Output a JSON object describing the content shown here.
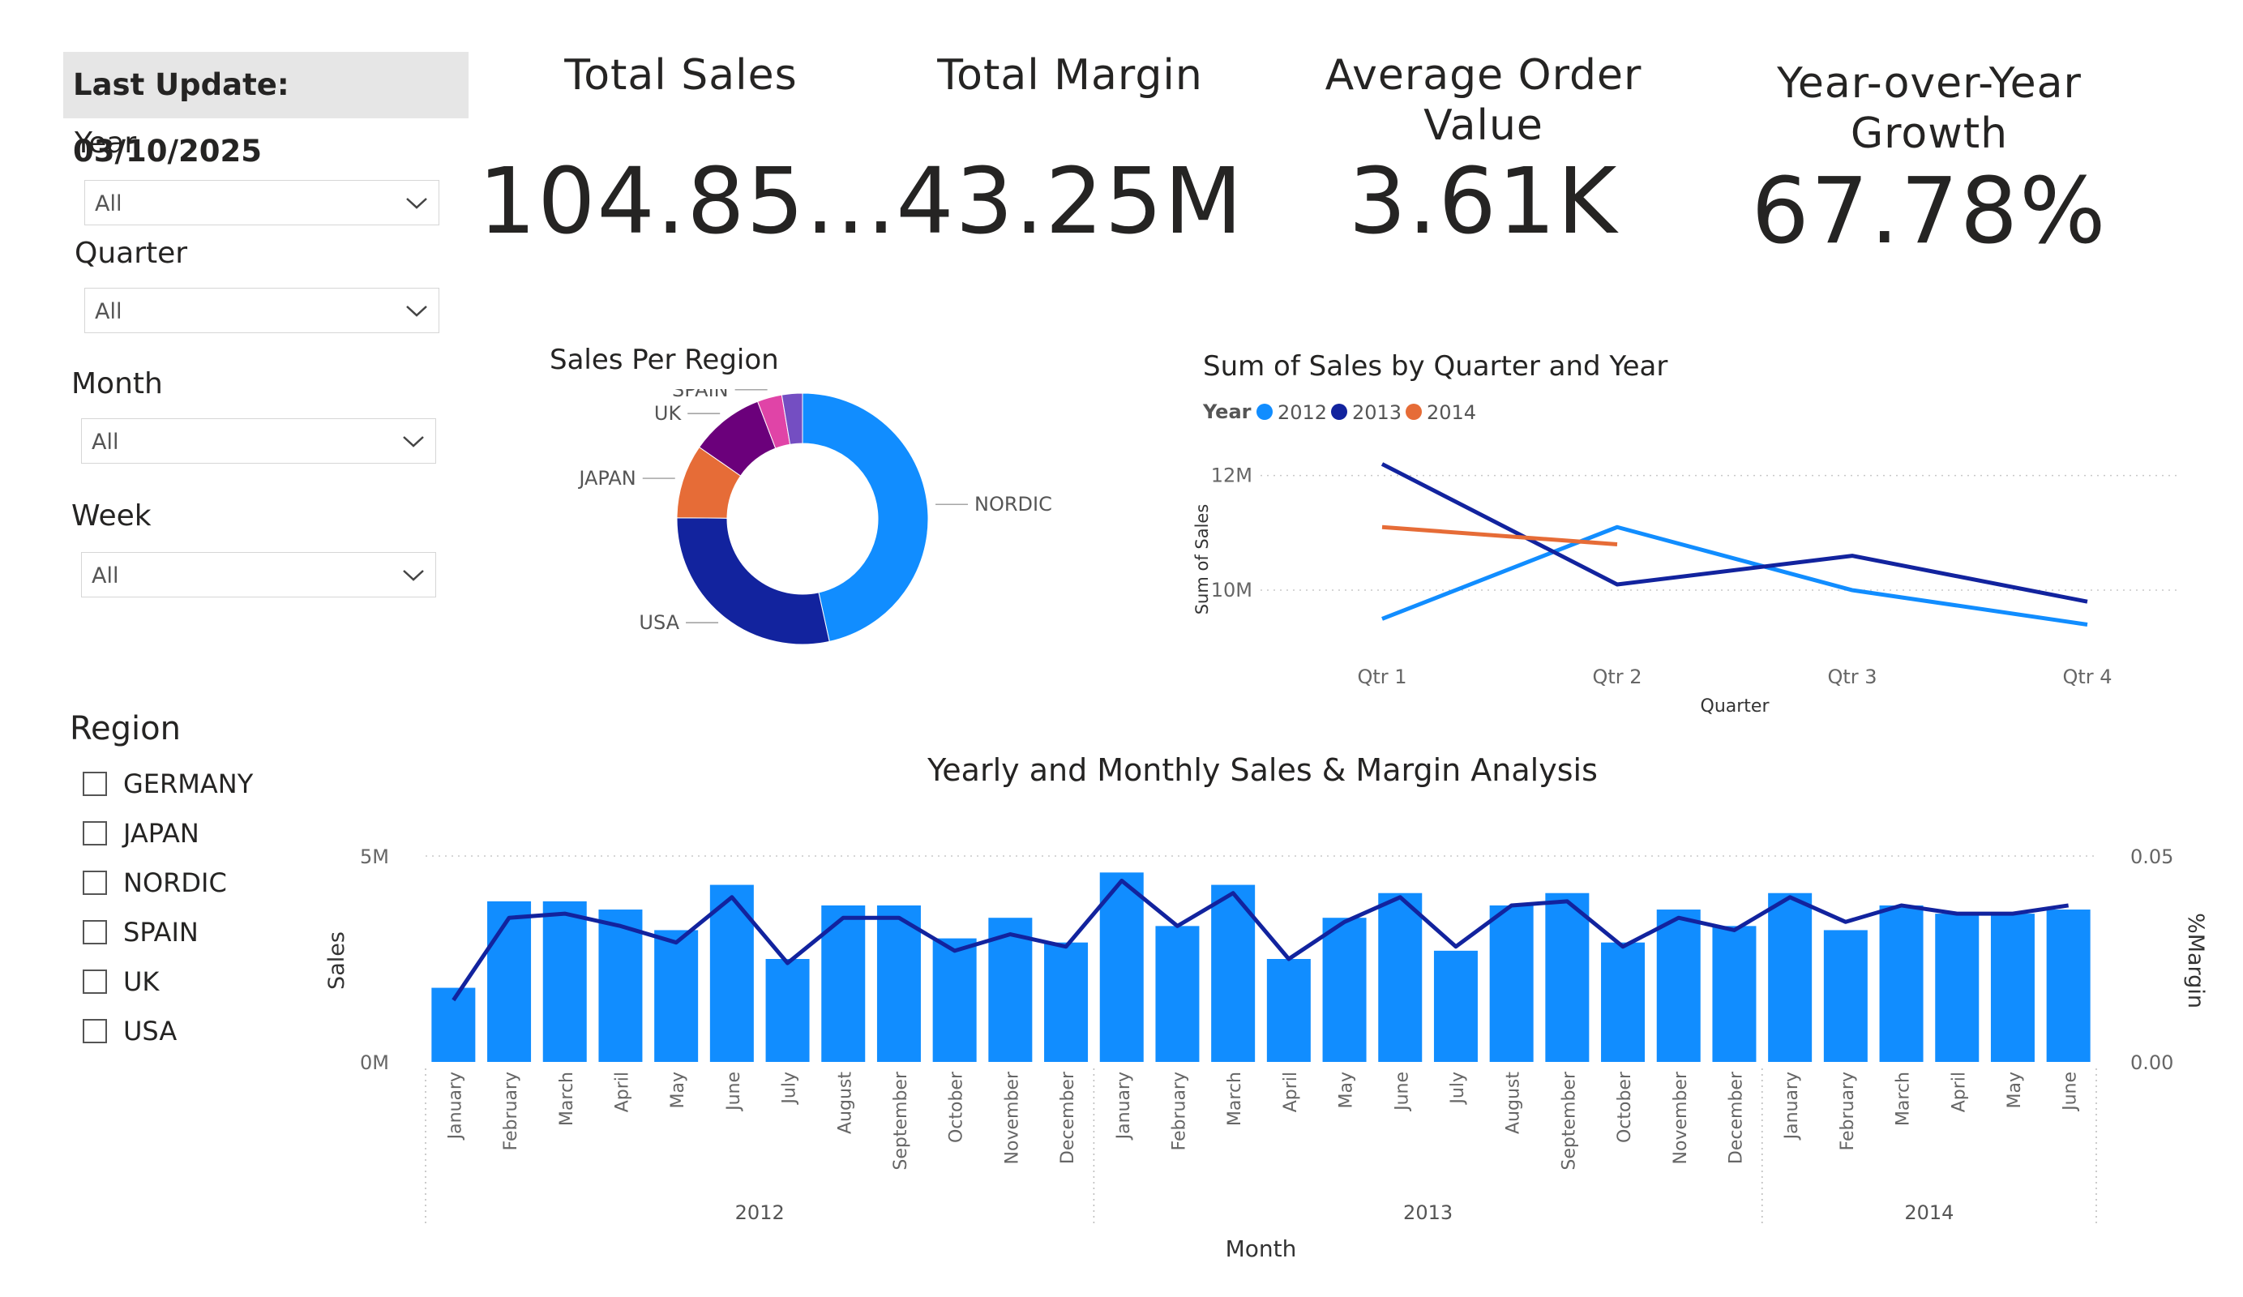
{
  "last_update": "Last Update: 03/10/2025",
  "slicers": [
    {
      "title": "Year",
      "value": "All"
    },
    {
      "title": "Quarter",
      "value": "All"
    },
    {
      "title": "Month",
      "value": "All"
    },
    {
      "title": "Week",
      "value": "All"
    }
  ],
  "region_filter": {
    "title": "Region",
    "items": [
      "GERMANY",
      "JAPAN",
      "NORDIC",
      "SPAIN",
      "UK",
      "USA"
    ]
  },
  "kpis": [
    {
      "title": "Total Sales",
      "value": "104.85..."
    },
    {
      "title": "Total Margin",
      "value": "43.25M"
    },
    {
      "title": "Average Order Value",
      "value": "3.61K"
    },
    {
      "title": "Year-over-Year Growth",
      "value": "67.78%"
    }
  ],
  "colors": {
    "nordic": "#118DFF",
    "usa": "#12239E",
    "japan": "#E66C37",
    "uk": "#6B007B",
    "spain": "#E044A7",
    "germany": "#744EC2",
    "y2012": "#118DFF",
    "y2013": "#12239E",
    "y2014": "#E66C37",
    "bar": "#118DFF",
    "margin_line": "#12239E"
  },
  "chart_data": [
    {
      "type": "pie",
      "title": "Sales Per Region",
      "labels": [
        "NORDIC",
        "USA",
        "JAPAN",
        "UK",
        "SPAIN",
        ""
      ],
      "values": [
        44,
        27,
        9,
        9,
        3,
        2.5
      ]
    },
    {
      "type": "line",
      "title": "Sum of Sales by Quarter and Year",
      "legend_title": "Year",
      "xlabel": "Quarter",
      "ylabel": "Sum of Sales",
      "categories": [
        "Qtr 1",
        "Qtr 2",
        "Qtr 3",
        "Qtr 4"
      ],
      "ylim": [
        8.7,
        12.8
      ],
      "yticks": [
        {
          "v": 12,
          "label": "12M"
        },
        {
          "v": 10,
          "label": "10M"
        }
      ],
      "series": [
        {
          "name": "2012",
          "values": [
            9.5,
            11.1,
            10.0,
            9.4
          ]
        },
        {
          "name": "2013",
          "values": [
            12.2,
            10.1,
            10.6,
            9.8
          ]
        },
        {
          "name": "2014",
          "values": [
            11.1,
            10.8,
            null,
            null
          ]
        }
      ]
    },
    {
      "type": "bar",
      "title": "Yearly and Monthly Sales & Margin Analysis",
      "xlabel": "Month",
      "ylabel": "Sales",
      "y2label": "%Margin",
      "ylim": [
        0,
        5
      ],
      "y2lim": [
        0,
        0.05
      ],
      "yticks": [
        {
          "v": 5,
          "label": "5M"
        },
        {
          "v": 0,
          "label": "0M"
        }
      ],
      "y2ticks": [
        {
          "v": 0.05,
          "label": "0.05"
        },
        {
          "v": 0,
          "label": "0.00"
        }
      ],
      "categories": [
        "January",
        "February",
        "March",
        "April",
        "May",
        "June",
        "July",
        "August",
        "September",
        "October",
        "November",
        "December",
        "January",
        "February",
        "March",
        "April",
        "May",
        "June",
        "July",
        "August",
        "September",
        "October",
        "November",
        "December",
        "January",
        "February",
        "March",
        "April",
        "May",
        "June"
      ],
      "groups": [
        {
          "name": "2012",
          "count": 12
        },
        {
          "name": "2013",
          "count": 12
        },
        {
          "name": "2014",
          "count": 6
        }
      ],
      "sales": [
        1.8,
        3.9,
        3.9,
        3.7,
        3.2,
        4.3,
        2.5,
        3.8,
        3.8,
        3.0,
        3.5,
        2.9,
        4.6,
        3.3,
        4.3,
        2.5,
        3.5,
        4.1,
        2.7,
        3.8,
        4.1,
        2.9,
        3.7,
        3.3,
        4.1,
        3.2,
        3.8,
        3.6,
        3.6,
        3.7
      ],
      "margin": [
        0.015,
        0.035,
        0.036,
        0.033,
        0.029,
        0.04,
        0.024,
        0.035,
        0.035,
        0.027,
        0.031,
        0.028,
        0.044,
        0.033,
        0.041,
        0.025,
        0.034,
        0.04,
        0.028,
        0.038,
        0.039,
        0.028,
        0.035,
        0.032,
        0.04,
        0.034,
        0.038,
        0.036,
        0.036,
        0.038
      ]
    }
  ]
}
